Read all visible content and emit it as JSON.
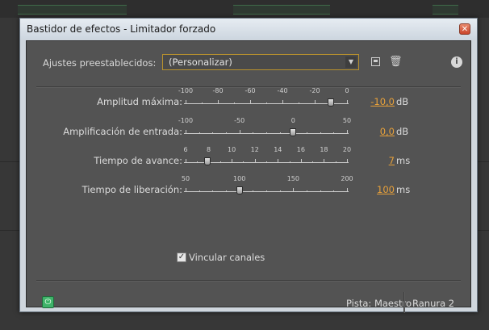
{
  "window": {
    "title": "Bastidor de efectos - Limitador forzado",
    "close_icon": "close-icon"
  },
  "presets": {
    "label": "Ajustes preestablecidos:",
    "value": "(Personalizar)",
    "icons": [
      "save-icon",
      "trash-icon",
      "info-icon"
    ]
  },
  "params": [
    {
      "label": "Amplitud máxima:",
      "ticks": [
        "-100",
        "-80",
        "-60",
        "-40",
        "-20",
        "0"
      ],
      "min": -100,
      "max": 0,
      "position": -10,
      "value": "-10,0",
      "unit": "dB"
    },
    {
      "label": "Amplificación de entrada:",
      "ticks": [
        "-100",
        "-50",
        "0",
        "50"
      ],
      "min": -100,
      "max": 50,
      "position": 0,
      "value": "0,0",
      "unit": "dB"
    },
    {
      "label": "Tiempo de avance:",
      "ticks": [
        "6",
        "8",
        "10",
        "12",
        "14",
        "16",
        "18",
        "20"
      ],
      "min": 5,
      "max": 20,
      "position": 7,
      "value": "7",
      "unit": "ms"
    },
    {
      "label": "Tiempo de liberación:",
      "ticks": [
        "50",
        "100",
        "150",
        "200"
      ],
      "min": 50,
      "max": 200,
      "position": 100,
      "value": "100",
      "unit": "ms"
    }
  ],
  "link_channels": {
    "label": "Vincular canales",
    "checked": true
  },
  "footer": {
    "power_icon": "power-icon",
    "track_label": "Pista: Maestro",
    "slot_label": "Ranura 2"
  },
  "colors": {
    "accent": "#e8a13a",
    "panel": "#535353",
    "power": "#3fb36a"
  }
}
